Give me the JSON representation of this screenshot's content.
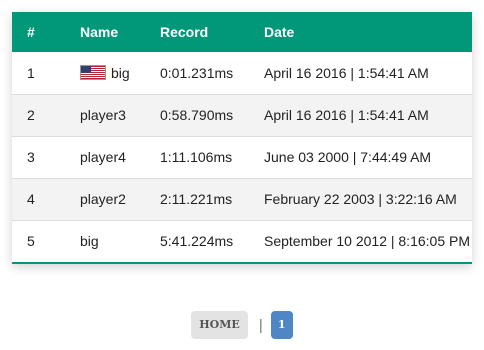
{
  "table": {
    "headers": {
      "num": "#",
      "name": "Name",
      "record": "Record",
      "date": "Date"
    },
    "rows": [
      {
        "num": "1",
        "name": "big",
        "flag": "us-flag-icon",
        "record": "0:01.231ms",
        "date": "April 16 2016 | 1:54:41 AM"
      },
      {
        "num": "2",
        "name": "player3",
        "record": "0:58.790ms",
        "date": "April 16 2016 | 1:54:41 AM"
      },
      {
        "num": "3",
        "name": "player4",
        "record": "1:11.106ms",
        "date": "June 03 2000 | 7:44:49 AM"
      },
      {
        "num": "4",
        "name": "player2",
        "record": "2:11.221ms",
        "date": "February 22 2003 | 3:22:16 AM"
      },
      {
        "num": "5",
        "name": "big",
        "record": "5:41.224ms",
        "date": "September 10 2012 | 8:16:05 PM"
      }
    ]
  },
  "pagination": {
    "home_label": "HOME",
    "separator": "|",
    "current_page": "1"
  },
  "colors": {
    "header_bg": "#009879",
    "alt_row_bg": "#f3f3f3",
    "page_active": "#4e86c6",
    "home_bg": "#e3e3e3"
  }
}
